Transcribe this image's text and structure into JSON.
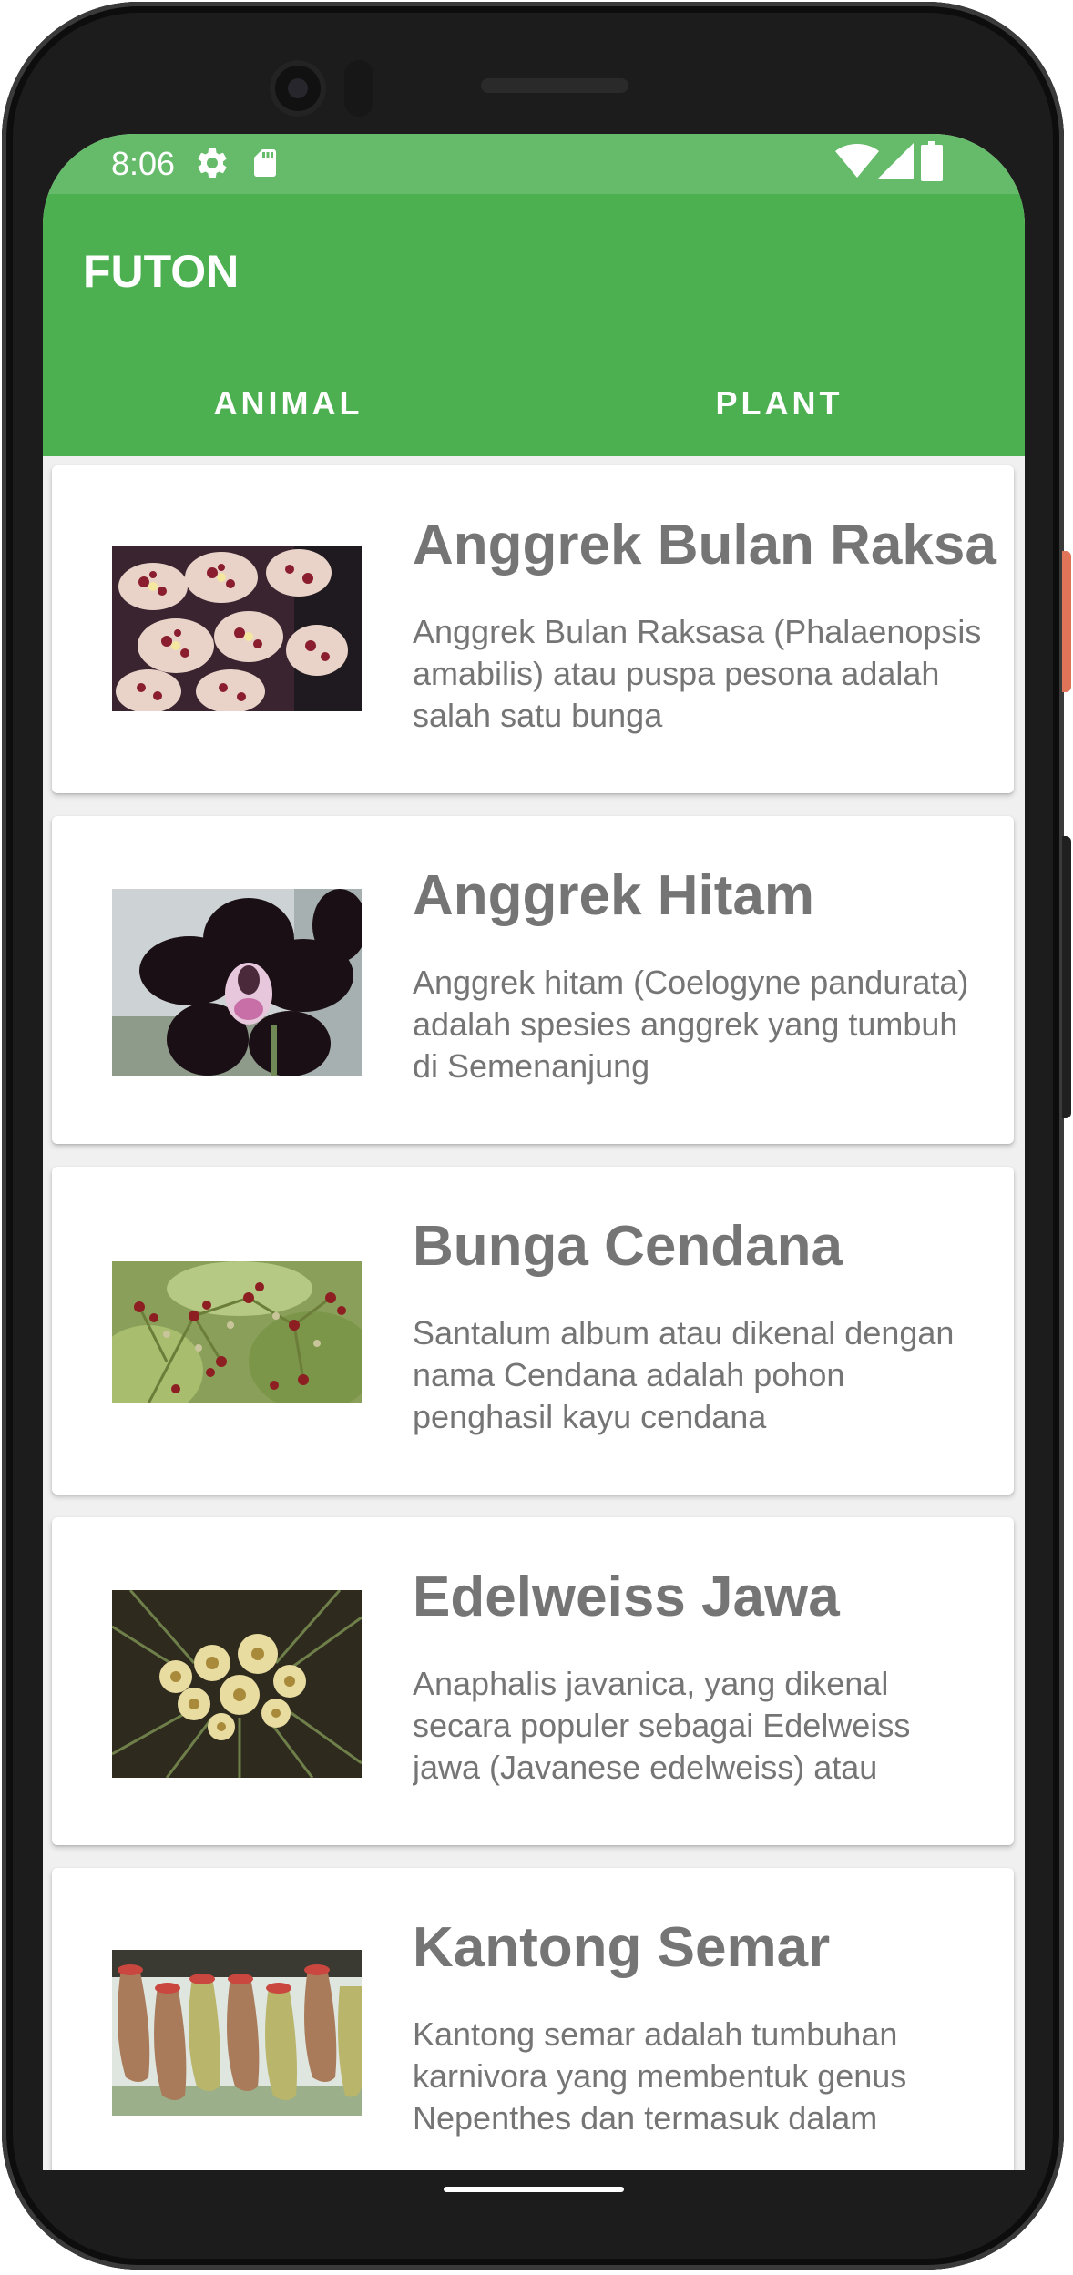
{
  "status_bar": {
    "time": "8:06",
    "left_icons": [
      "gear-icon",
      "sd-card-icon"
    ],
    "right_icons": [
      "wifi-icon",
      "cell-signal-icon",
      "battery-icon"
    ]
  },
  "app_bar": {
    "title": "FUTON",
    "background": "#4caf50",
    "status_background": "#66bb6a"
  },
  "tabs": [
    {
      "label": "ANIMAL"
    },
    {
      "label": "PLANT"
    }
  ],
  "plants": [
    {
      "title": "Anggrek Bulan Raksa",
      "description": "Anggrek Bulan Raksasa (Phalaenopsis amabilis) atau puspa pesona adalah salah satu bunga",
      "image": "spotted-orchid-photo"
    },
    {
      "title": "Anggrek Hitam",
      "description": "Anggrek hitam (Coelogyne pandurata) adalah spesies anggrek yang tumbuh di Semenanjung",
      "image": "black-orchid-photo"
    },
    {
      "title": "Bunga Cendana",
      "description": "Santalum album atau dikenal dengan nama Cendana adalah pohon penghasil kayu cendana",
      "image": "sandalwood-flower-photo"
    },
    {
      "title": "Edelweiss Jawa",
      "description": "Anaphalis javanica, yang dikenal secara populer sebagai Edelweiss jawa (Javanese edelweiss) atau",
      "image": "edelweiss-photo"
    },
    {
      "title": "Kantong Semar",
      "description": "Kantong semar adalah tumbuhan karnivora yang membentuk genus Nepenthes dan termasuk dalam",
      "image": "pitcher-plant-photo"
    }
  ]
}
